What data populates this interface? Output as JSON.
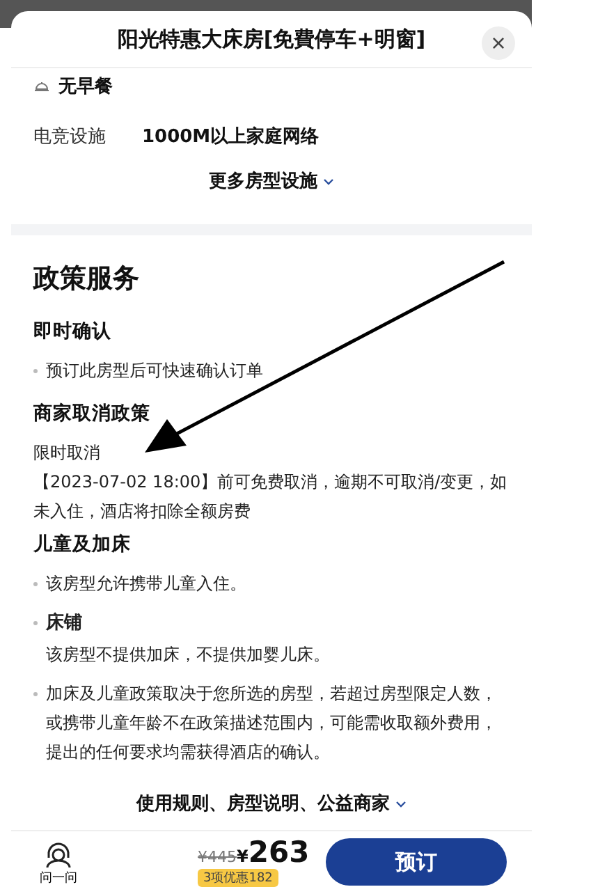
{
  "sheet": {
    "title": "阳光特惠大床房[免費停车+明窗]",
    "close": "×"
  },
  "amenities": [
    {
      "kind": "icon",
      "value": "无早餐"
    },
    {
      "kind": "labeled",
      "label": "电竞设施",
      "value": "1000M以上家庭网络"
    }
  ],
  "more_link": "更多房型设施",
  "policy": {
    "heading": "政策服务",
    "sections": [
      {
        "title": "即时确认",
        "items": [
          {
            "kind": "bullet",
            "text": "预订此房型后可快速确认订单"
          }
        ]
      },
      {
        "title": "商家取消政策",
        "items": [
          {
            "kind": "plain",
            "text": "限时取消"
          },
          {
            "kind": "plain",
            "text": "【2023-07-02 18:00】前可免费取消，逾期不可取消/变更，如未入住，酒店将扣除全额房费"
          }
        ]
      },
      {
        "title": "儿童及加床",
        "items": [
          {
            "kind": "bullet",
            "text": "该房型允许携带儿童入住。"
          },
          {
            "kind": "subhead",
            "text": "床铺"
          },
          {
            "kind": "indent",
            "text": "该房型不提供加床，不提供加婴儿床。"
          },
          {
            "kind": "bullet",
            "text": "加床及儿童政策取决于您所选的房型，若超过房型限定人数，或携带儿童年龄不在政策描述范围内，可能需收取额外费用，提出的任何要求均需获得酒店的确认。"
          }
        ]
      }
    ]
  },
  "rules_link": "使用规则、房型说明、公益商家",
  "footer": {
    "ask_label": "问一问",
    "original_price": "¥445",
    "currency": "¥",
    "price": "263",
    "discount": "3项优惠182",
    "book_button": "预订"
  }
}
